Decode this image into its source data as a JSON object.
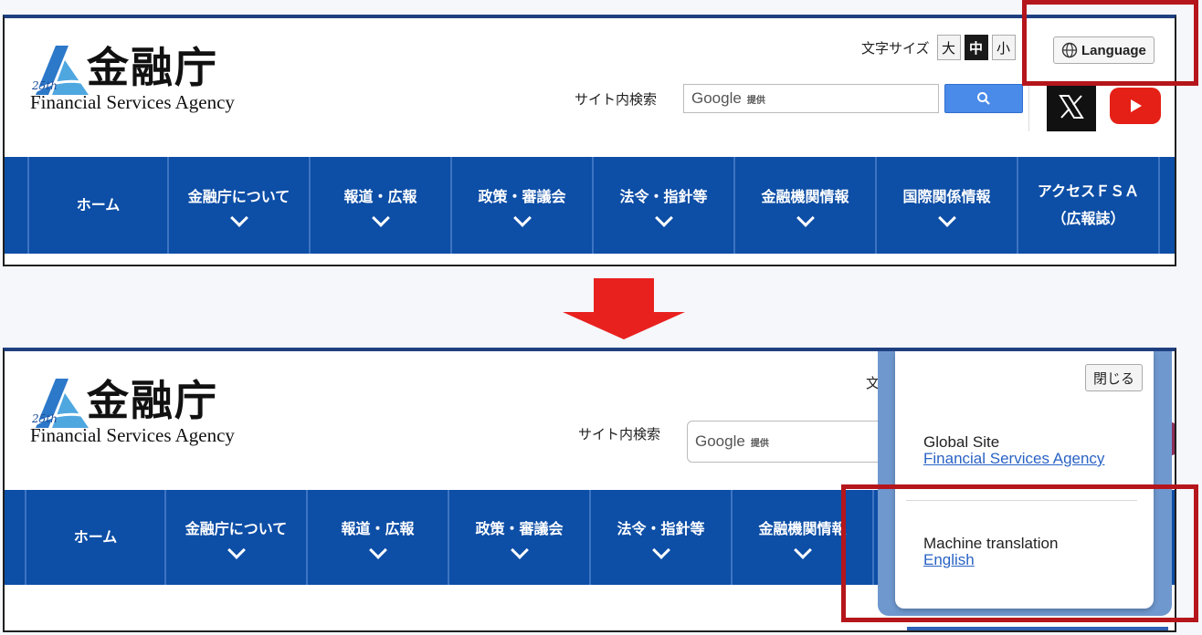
{
  "header": {
    "logo_title": "金融庁",
    "logo_subtitle": "Financial Services Agency",
    "logo_badge": "25th",
    "fontsize_label": "文字サイズ",
    "fontsize_large": "大",
    "fontsize_medium": "中",
    "fontsize_small": "小",
    "language_label": "Language",
    "search_label": "サイト内検索",
    "search_google": "Google",
    "search_provided": "提供"
  },
  "nav": {
    "items": [
      {
        "label": "ホーム",
        "has_dropdown": false
      },
      {
        "label": "金融庁について",
        "has_dropdown": true
      },
      {
        "label": "報道・広報",
        "has_dropdown": true
      },
      {
        "label": "政策・審議会",
        "has_dropdown": true
      },
      {
        "label": "法令・指針等",
        "has_dropdown": true
      },
      {
        "label": "金融機関情報",
        "has_dropdown": true
      },
      {
        "label": "国際関係情報",
        "has_dropdown": true
      },
      {
        "label": "アクセスＦＳＡ",
        "label_line2": "（広報誌）",
        "has_dropdown": false
      }
    ]
  },
  "popup": {
    "close_label": "閉じる",
    "global_heading": "Global Site",
    "global_link": "Financial Services Agency",
    "machine_heading": "Machine translation",
    "machine_link": "English"
  },
  "colors": {
    "nav_bg": "#0d4ea6",
    "highlight": "#b5161b",
    "arrow": "#e8211f",
    "search_button": "#4a8ae8",
    "youtube_red": "#e52017"
  }
}
